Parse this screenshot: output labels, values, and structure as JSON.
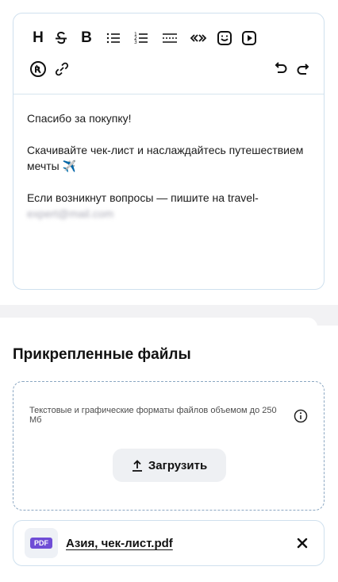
{
  "editor": {
    "toolbar": {
      "heading_label": "H",
      "bold_label": "B",
      "icons": [
        "heading-icon",
        "strikethrough-icon",
        "bold-icon",
        "bulleted-list-icon",
        "numbered-list-icon",
        "divider-icon",
        "quote-icon",
        "emoji-icon",
        "video-icon",
        "special-char-icon",
        "link-icon",
        "undo-icon",
        "redo-icon"
      ]
    },
    "paragraphs": [
      "Спасибо за покупку!",
      "Скачивайте чек-лист и наслаждайтесь путешествием мечты ✈️",
      "Если возникнут вопросы — пишите на travel-"
    ],
    "email_continuation": "expert@mail.com"
  },
  "attachments": {
    "title": "Прикрепленные файлы",
    "hint": "Текстовые и графические форматы файлов объемом до 250 Мб",
    "upload_label": "Загрузить",
    "files": [
      {
        "badge": "PDF",
        "name": "Азия, чек-лист.pdf"
      }
    ]
  },
  "colors": {
    "border": "#cfe0ee",
    "dashed_border": "#8ba7c2",
    "pdf_badge": "#6f4dd6",
    "button_bg": "#eef0f3"
  }
}
